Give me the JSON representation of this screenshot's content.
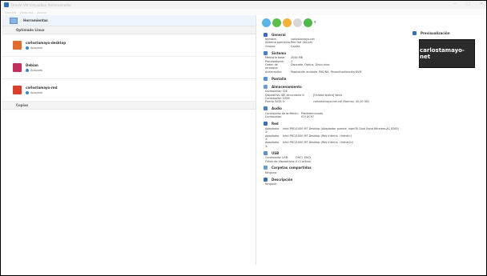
{
  "window": {
    "title": "Oracle VM VirtualBox Administrador",
    "controls": [
      "—",
      "□",
      "✕"
    ]
  },
  "menu": [
    "Archivo",
    "Máquina",
    "Ayuda"
  ],
  "sidebar": {
    "tools_label": "Herramientas",
    "group_label": "Optimado Linux",
    "vms": [
      {
        "name": "carlostamayo-desktop",
        "state": "Apagada",
        "color": "#e06c2f"
      },
      {
        "name": "Debian",
        "state": "Apagada",
        "color": "#c0305a"
      },
      {
        "name": "carlostamayo-red",
        "state": "Apagada",
        "color": "#d9402b"
      }
    ],
    "group2_label": "Copias"
  },
  "toolbar": {
    "icons": [
      "new-icon",
      "add-icon",
      "settings-icon",
      "discard-icon",
      "start-icon"
    ],
    "dropdown": "▾"
  },
  "details": {
    "general": {
      "title": "General",
      "rows": [
        {
          "k": "Nombre:",
          "v": "carlostamayo-net"
        },
        {
          "k": "Sistema operativo:",
          "v": "Red Hat (64-bit)"
        },
        {
          "k": "Grupos:",
          "v": "Copias"
        }
      ]
    },
    "system": {
      "title": "Sistema",
      "rows": [
        {
          "k": "Memoria base:",
          "v": "2048 MB"
        },
        {
          "k": "Procesadores:",
          "v": "2"
        },
        {
          "k": "Orden de arranque:",
          "v": "Disquete, Óptica, Disco duro"
        },
        {
          "k": "Aceleración:",
          "v": "Paginación anidada, PAE/NX, Paravirtualización KVM"
        }
      ]
    },
    "display": {
      "title": "Pantalla"
    },
    "storage": {
      "title": "Almacenamiento",
      "rows": [
        {
          "k": "Controlador: IDE",
          "v": ""
        },
        {
          "k": "  Dispositivo IDE secundario 0:",
          "v": "[Unidad óptica] Vacío"
        },
        {
          "k": "Controlador: SATA",
          "v": ""
        },
        {
          "k": "  Puerto SATA 0:",
          "v": "carlostamayo-net.vdi (Normal, 40,00 GB)"
        }
      ]
    },
    "audio": {
      "title": "Audio",
      "rows": [
        {
          "k": "Controlador de anfitrión:",
          "v": "Predeterminado"
        },
        {
          "k": "Controlador:",
          "v": "ICH AC97"
        }
      ]
    },
    "network": {
      "title": "Red",
      "rows": [
        {
          "k": "Adaptador 1:",
          "v": "Intel PRO/1000 MT Desktop (Adaptador puente, Intel(R) Dual Band Wireless-AC 8265)"
        },
        {
          "k": "Adaptador 2:",
          "v": "Intel PRO/1000 MT Desktop (Red interna, «intnet»)"
        },
        {
          "k": "Adaptador 3:",
          "v": "Intel PRO/1000 MT Desktop (Red interna, «intnet2»)"
        }
      ]
    },
    "usb": {
      "title": "USB",
      "rows": [
        {
          "k": "Controlador USB:",
          "v": "OHCI, EHCI"
        },
        {
          "k": "Filtros de dispositivos:",
          "v": "0 (0 activo)"
        }
      ]
    },
    "shared": {
      "title": "Carpetas compartidas",
      "rows": [
        {
          "k": "Ninguna",
          "v": ""
        }
      ]
    },
    "description": {
      "title": "Descripción",
      "rows": [
        {
          "k": "Ninguna",
          "v": ""
        }
      ]
    }
  },
  "preview": {
    "title": "Previsualización",
    "screen_text": "carlostamayo-net"
  }
}
